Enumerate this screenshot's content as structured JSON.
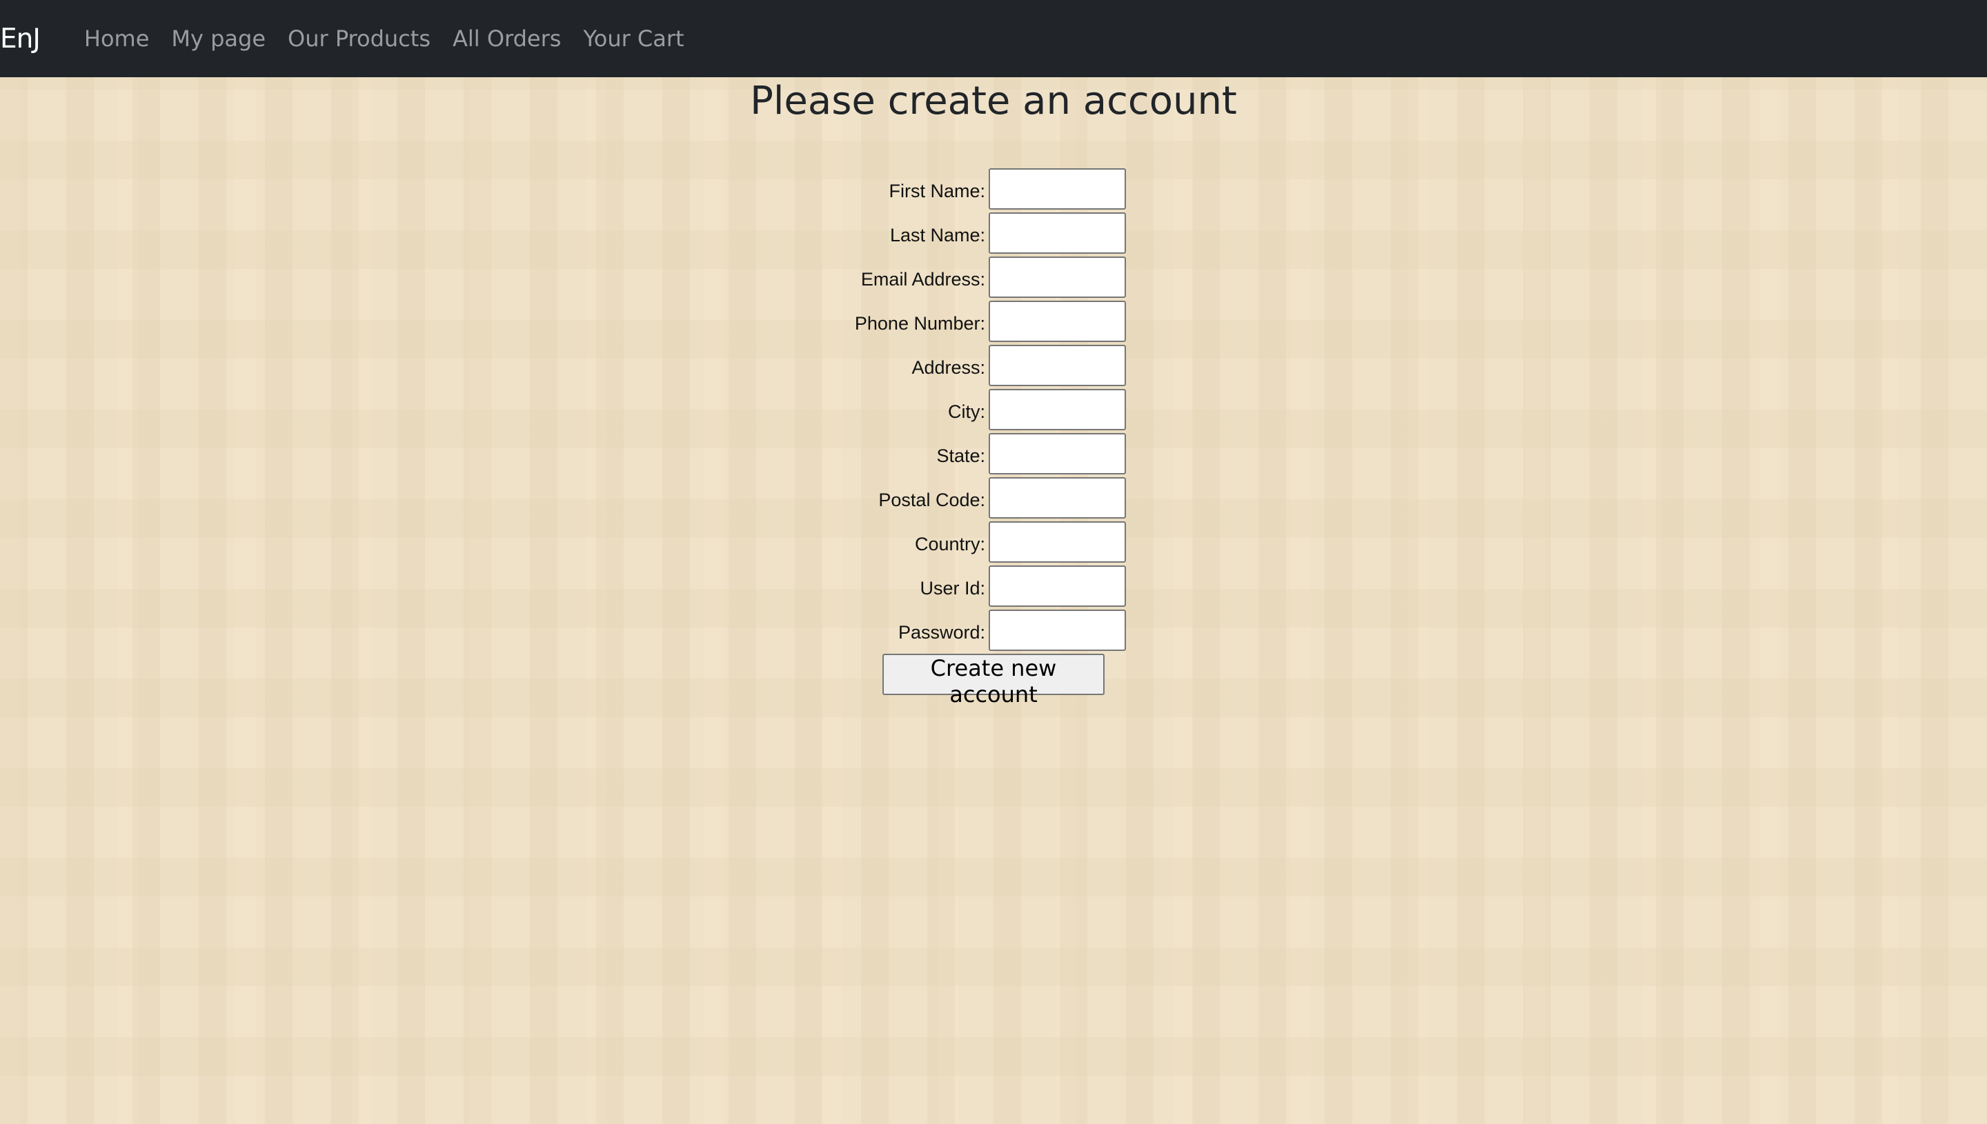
{
  "navbar": {
    "brand": "EnJ",
    "items": [
      {
        "label": "Home"
      },
      {
        "label": "My page"
      },
      {
        "label": "Our Products"
      },
      {
        "label": "All Orders"
      },
      {
        "label": "Your Cart"
      }
    ]
  },
  "page": {
    "title": "Please create an account"
  },
  "form": {
    "fields": [
      {
        "label": "First Name:",
        "value": ""
      },
      {
        "label": "Last Name:",
        "value": ""
      },
      {
        "label": "Email Address:",
        "value": ""
      },
      {
        "label": "Phone Number:",
        "value": ""
      },
      {
        "label": "Address:",
        "value": ""
      },
      {
        "label": "City:",
        "value": ""
      },
      {
        "label": "State:",
        "value": ""
      },
      {
        "label": "Postal Code:",
        "value": ""
      },
      {
        "label": "Country:",
        "value": ""
      },
      {
        "label": "User Id:",
        "value": ""
      },
      {
        "label": "Password:",
        "value": ""
      }
    ],
    "submit_label": "Create new account"
  },
  "colors": {
    "navbar_bg": "#212529",
    "page_bg": "#efe2c8",
    "nav_link": "rgba(255,255,255,0.55)",
    "brand": "#ffffff"
  }
}
